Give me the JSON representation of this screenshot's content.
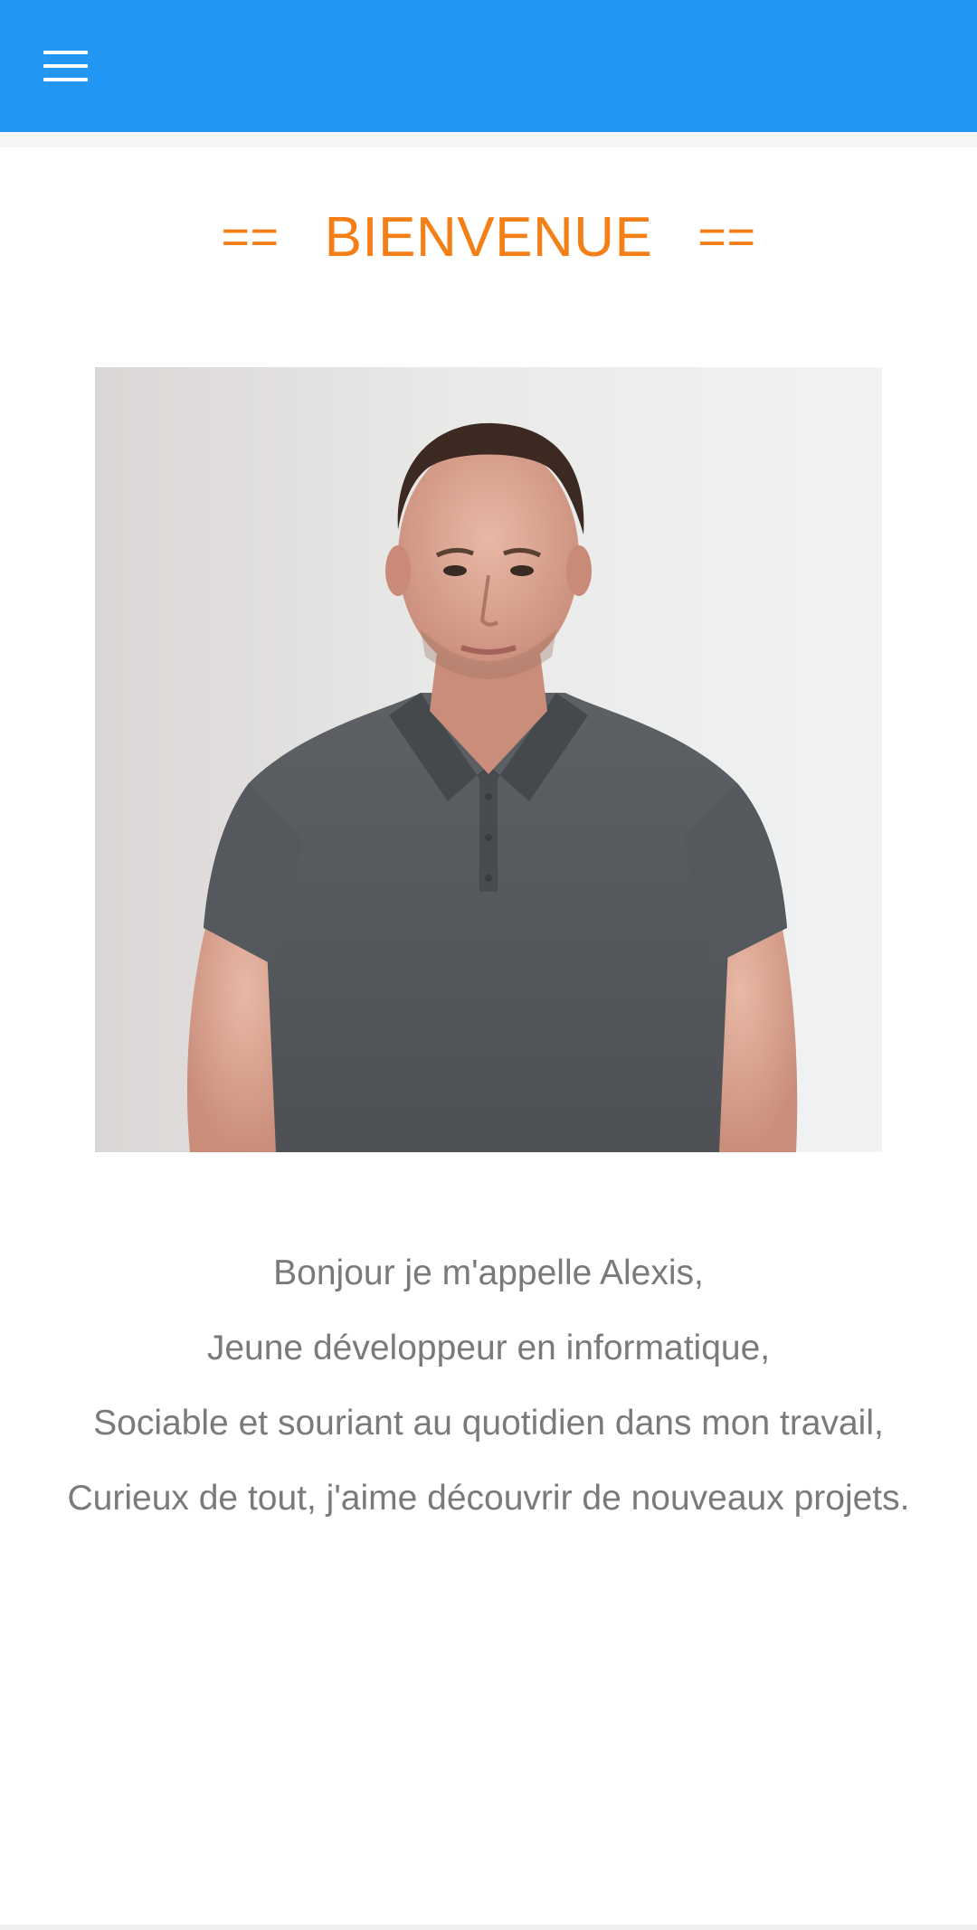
{
  "header": {
    "menu_icon": "hamburger-menu-icon",
    "background_color": "#2196f3"
  },
  "main": {
    "title": {
      "left_decoration": "==",
      "text": "BIENVENUE",
      "right_decoration": "==",
      "color": "#f57f17"
    },
    "intro_lines": [
      "Bonjour je m'appelle Alexis,",
      "Jeune développeur en informatique,",
      "Sociable et souriant au quotidien dans mon travail,",
      "Curieux de tout, j'aime découvrir de nouveaux projets."
    ],
    "text_color": "#7a7a7a"
  }
}
